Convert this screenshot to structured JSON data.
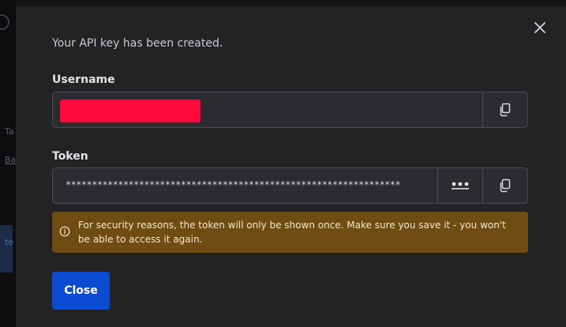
{
  "background": {
    "fragment_1": "Ta",
    "fragment_2": "Ba",
    "fragment_3": "te"
  },
  "dialog": {
    "intro_text": "Your API key has been created.",
    "close_icon": "close-icon",
    "username": {
      "label": "Username",
      "value_redacted": true,
      "copy_icon": "copy-icon"
    },
    "token": {
      "label": "Token",
      "masked_value": "****************************************************************",
      "reveal_icon": "ellipsis-icon",
      "copy_icon": "copy-icon"
    },
    "warning": {
      "icon": "info-icon",
      "text": "For security reasons, the token will only be shown once. Make sure you save it - you won't be able to access it again."
    },
    "close_button_label": "Close"
  },
  "colors": {
    "modal_bg": "#232326",
    "field_bg": "#2c2c30",
    "warning_bg": "#6e4c12",
    "primary": "#0b4bd1",
    "redaction": "#ff0a3c"
  }
}
